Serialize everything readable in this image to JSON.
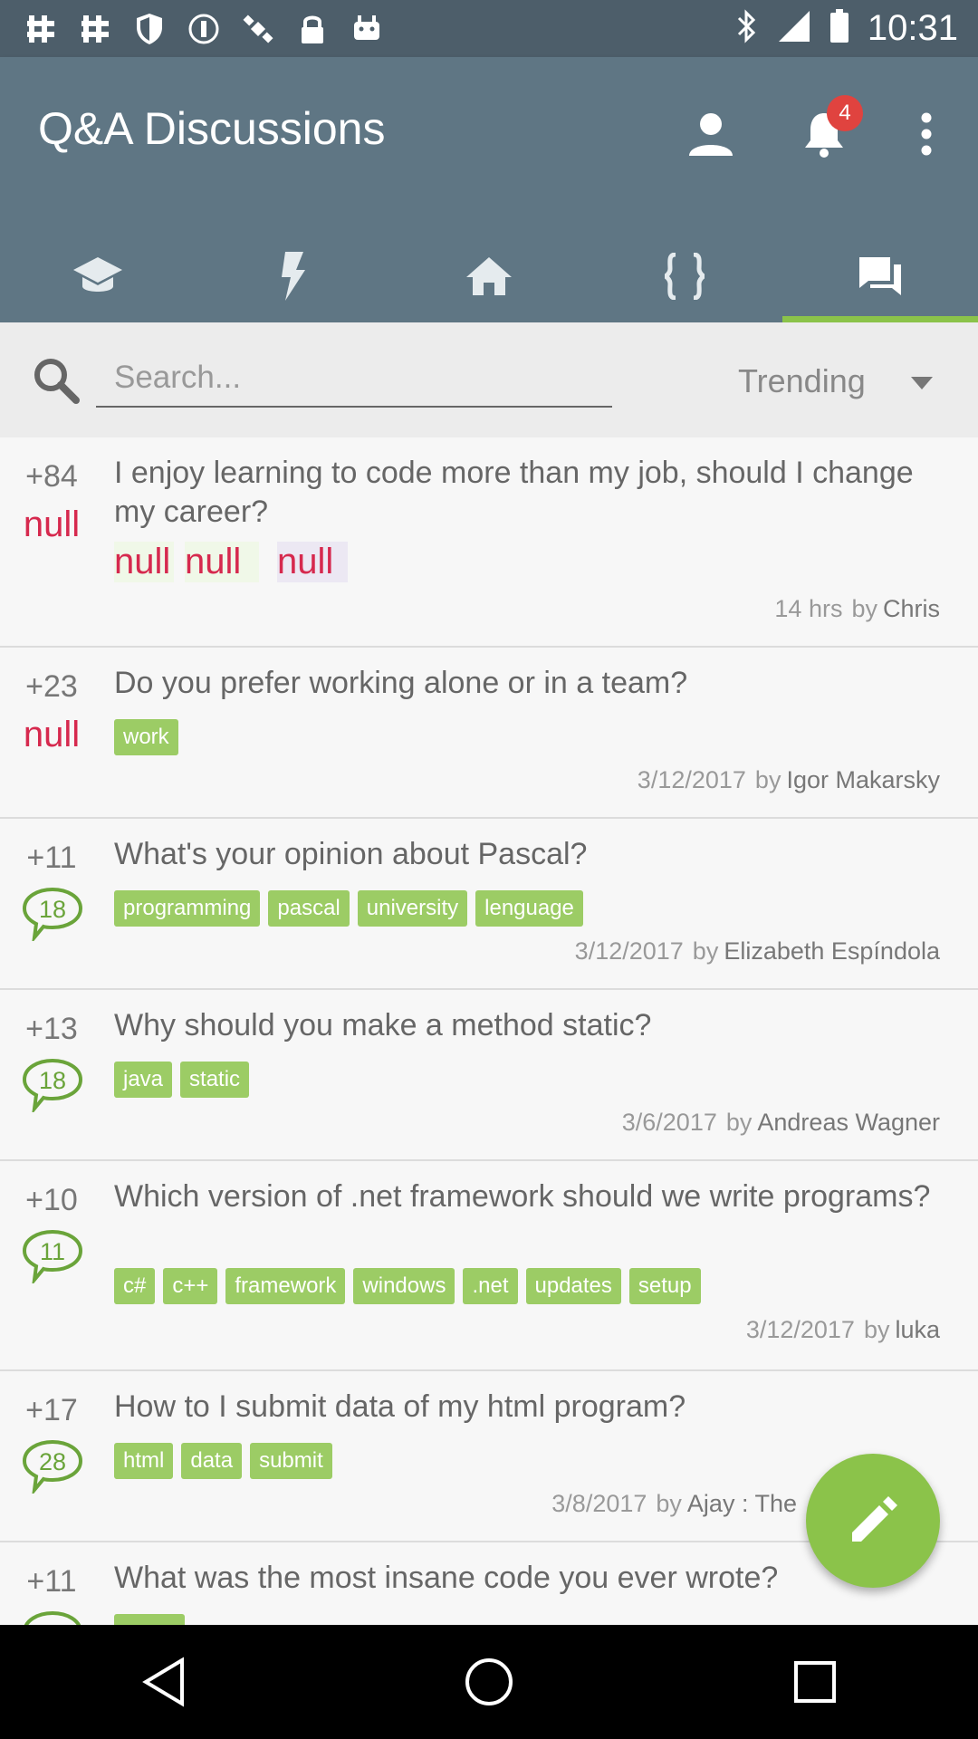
{
  "status_bar": {
    "time": "10:31",
    "left_icons": [
      "slack-icon",
      "slack-icon",
      "shield-icon",
      "vpn-icon",
      "satellite-icon",
      "lock-icon",
      "android-icon"
    ],
    "right_icons": [
      "bluetooth-icon",
      "signal-icon",
      "battery-icon"
    ]
  },
  "app_bar": {
    "title": "Q&A Discussions",
    "notification_count": "4",
    "actions": [
      "profile-icon",
      "bell-icon",
      "more-vert-icon"
    ]
  },
  "tabs": [
    {
      "icon": "school-icon",
      "active": false
    },
    {
      "icon": "flash-icon",
      "active": false
    },
    {
      "icon": "home-icon",
      "active": false
    },
    {
      "icon": "braces-icon",
      "active": false
    },
    {
      "icon": "forum-icon",
      "active": true
    }
  ],
  "search": {
    "placeholder": "Search...",
    "sort_selected": "Trending"
  },
  "posts": [
    {
      "votes": "+84",
      "answers": "null",
      "title": "I enjoy learning to code more than my job, should I change my career?",
      "tags": [
        "null",
        "null",
        "null"
      ],
      "time": "14 hrs",
      "by": "by",
      "author": "Chris"
    },
    {
      "votes": "+23",
      "answers": "null",
      "title": "Do you prefer working alone or in a team?",
      "tags": [
        "work"
      ],
      "time": "3/12/2017",
      "by": "by",
      "author": "Igor Makarsky"
    },
    {
      "votes": "+11",
      "answers": "18",
      "title": "What's your opinion about Pascal?",
      "tags": [
        "programming",
        "pascal",
        "university",
        "lenguage"
      ],
      "time": "3/12/2017",
      "by": "by",
      "author": "Elizabeth Espíndola"
    },
    {
      "votes": "+13",
      "answers": "18",
      "title": "Why should you make a method static?",
      "tags": [
        "java",
        "static"
      ],
      "time": "3/6/2017",
      "by": "by",
      "author": "Andreas Wagner"
    },
    {
      "votes": "+10",
      "answers": "11",
      "title": "Which version of .net framework should we write programs?",
      "tags": [
        "c#",
        "c++",
        "framework",
        "windows",
        ".net",
        "updates",
        "setup"
      ],
      "time": "3/12/2017",
      "by": "by",
      "author": "luka"
    },
    {
      "votes": "+17",
      "answers": "28",
      "title": "How to I submit data of my html program?",
      "tags": [
        "html",
        "data",
        "submit"
      ],
      "time": "3/8/2017",
      "by": "by",
      "author": "Ajay : The"
    },
    {
      "votes": "+11",
      "answers": "",
      "title": "What was the most insane code you ever wrote?",
      "tags": [],
      "time": "",
      "by": "",
      "author": ""
    }
  ],
  "fab": {
    "icon": "edit-icon"
  },
  "nav_bar": {
    "icons": [
      "back-icon",
      "home-circle-icon",
      "recents-icon"
    ]
  },
  "colors": {
    "app_bar": "#5f7684",
    "status_bar": "#4d5e6a",
    "accent_green": "#8bc34a",
    "tag_green": "#9ccc65",
    "null_red": "#d6294e",
    "badge_red": "#e0433f"
  }
}
